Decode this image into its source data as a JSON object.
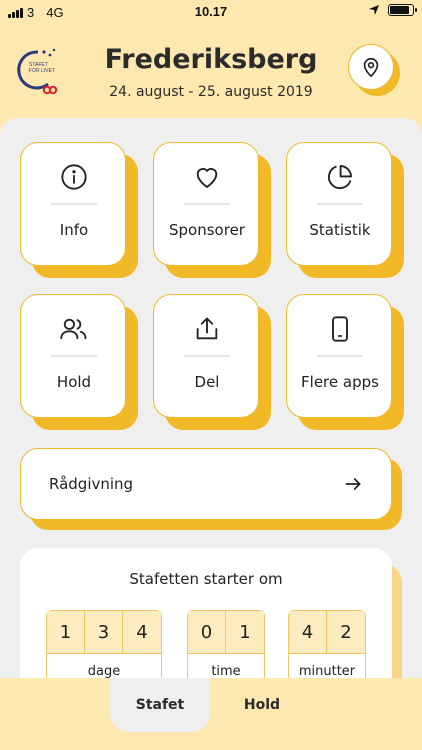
{
  "status_bar": {
    "carrier": "3",
    "network": "4G",
    "time": "10.17"
  },
  "header": {
    "logo_text_line1": "STAFET",
    "logo_text_line2": "FOR LIVET",
    "title": "Frederiksberg",
    "dates": "24. august - 25. august 2019",
    "location_icon": "location-pin-icon"
  },
  "tiles": [
    {
      "label": "Info",
      "icon": "info-icon"
    },
    {
      "label": "Sponsorer",
      "icon": "heart-icon"
    },
    {
      "label": "Statistik",
      "icon": "pie-chart-icon"
    },
    {
      "label": "Hold",
      "icon": "users-icon"
    },
    {
      "label": "Del",
      "icon": "share-icon"
    },
    {
      "label": "Flere apps",
      "icon": "phone-icon"
    }
  ],
  "advice": {
    "label": "Rådgivning",
    "icon": "arrow-right-icon"
  },
  "countdown": {
    "title": "Stafetten starter om",
    "days": {
      "digits": [
        "1",
        "3",
        "4"
      ],
      "label": "dage"
    },
    "hours": {
      "digits": [
        "0",
        "1"
      ],
      "label": "time"
    },
    "minutes": {
      "digits": [
        "4",
        "2"
      ],
      "label": "minutter"
    }
  },
  "tabs": [
    {
      "label": "Stafet",
      "active": true
    },
    {
      "label": "Hold",
      "active": false
    }
  ],
  "colors": {
    "accent": "#f1b928",
    "background": "#fde9b0",
    "panel": "#efefef"
  }
}
